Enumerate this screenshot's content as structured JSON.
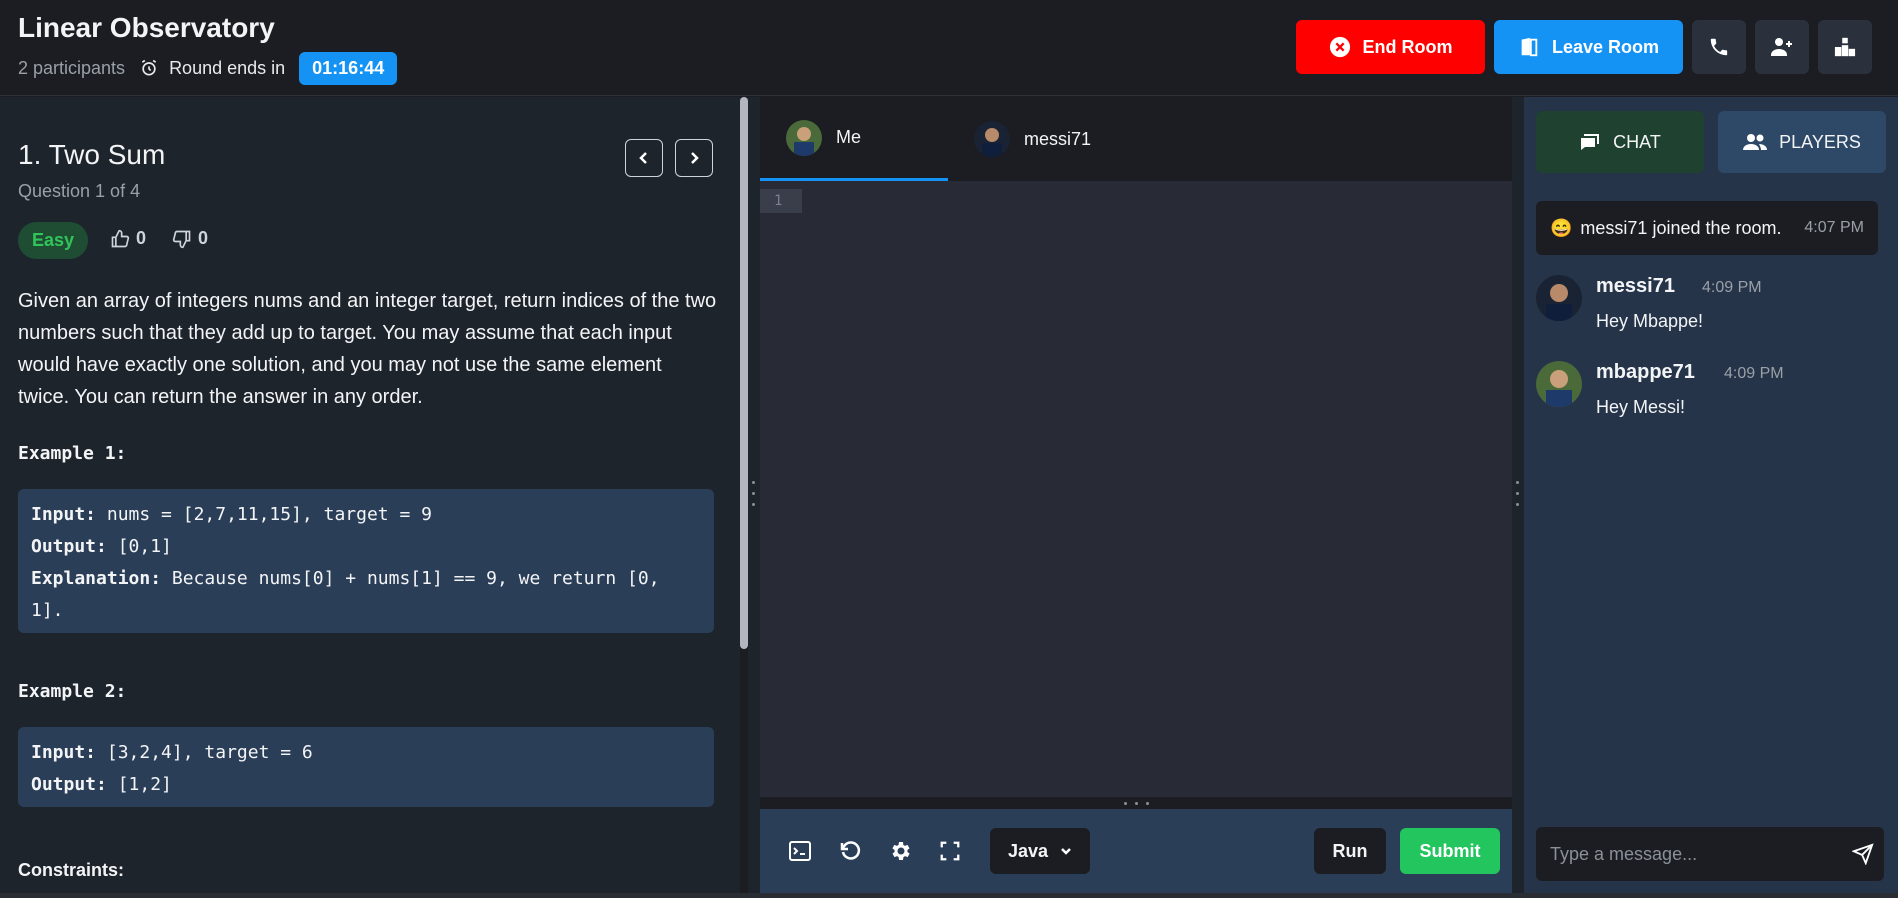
{
  "header": {
    "title": "Linear Observatory",
    "participants": "2 participants",
    "round_label": "Round ends in",
    "timer": "01:16:44",
    "end_room": "End Room",
    "leave_room": "Leave Room"
  },
  "question": {
    "title": "1. Two Sum",
    "count": "Question 1 of 4",
    "difficulty": "Easy",
    "likes": "0",
    "dislikes": "0",
    "description": "Given an array of integers nums and an integer target, return indices of the two numbers such that they add up to target. You may assume that each input would have exactly one solution, and you may not use the same element twice. You can return the answer in any order.",
    "examples": [
      {
        "heading": "Example 1:",
        "input_label": "Input:",
        "input": " nums = [2,7,11,15], target = 9",
        "output_label": "Output:",
        "output": " [0,1]",
        "explanation_label": "Explanation:",
        "explanation": " Because nums[0] + nums[1] == 9, we return [0, 1]."
      },
      {
        "heading": "Example 2:",
        "input_label": "Input:",
        "input": " [3,2,4], target = 6",
        "output_label": "Output:",
        "output": " [1,2]"
      }
    ],
    "constraints_heading": "Constraints:"
  },
  "editor": {
    "tabs": [
      {
        "label": "Me",
        "active": true
      },
      {
        "label": "messi71",
        "active": false
      }
    ],
    "line_number": "1",
    "language": "Java",
    "run": "Run",
    "submit": "Submit"
  },
  "sidebar": {
    "tab_chat": "CHAT",
    "tab_players": "PLAYERS",
    "system_message": {
      "emoji": "😄",
      "text": "messi71 joined the room.",
      "time": "4:07 PM"
    },
    "messages": [
      {
        "user": "messi71",
        "time": "4:09 PM",
        "text": "Hey Mbappe!"
      },
      {
        "user": "mbappe71",
        "time": "4:09 PM",
        "text": "Hey Messi!"
      }
    ],
    "input_placeholder": "Type a message..."
  },
  "colors": {
    "accent_blue": "#1493f5",
    "danger_red": "#ff0000",
    "success_green": "#22c55e",
    "easy_green": "#31c45a"
  }
}
